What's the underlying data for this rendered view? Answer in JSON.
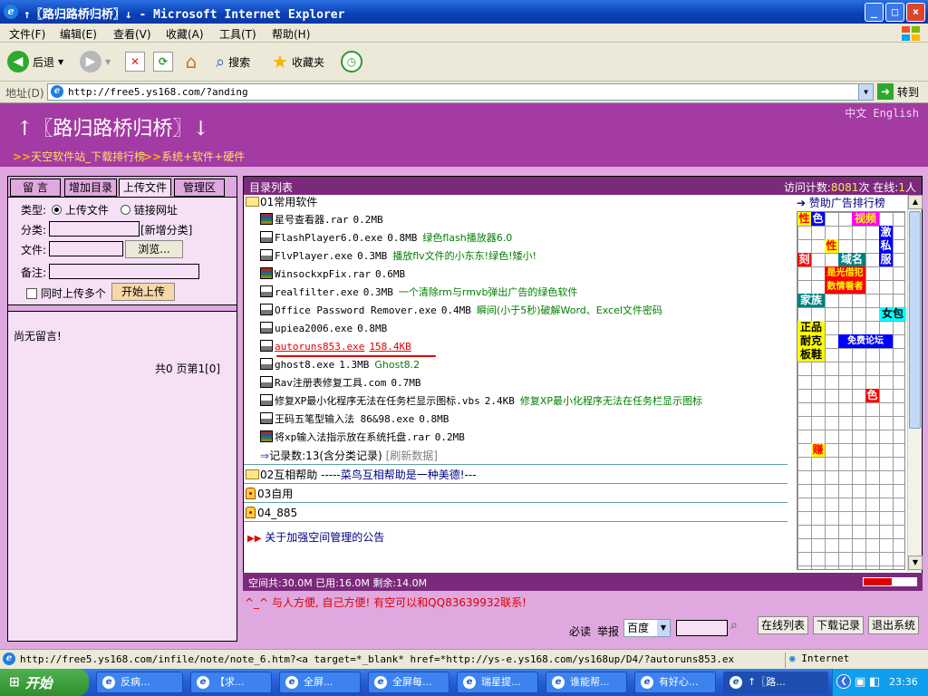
{
  "window": {
    "title": "↑〖路归路桥归桥〗↓ - Microsoft Internet Explorer",
    "controls": {
      "minimize": "_",
      "maximize": "□",
      "close": "×"
    }
  },
  "menu": [
    "文件(F)",
    "编辑(E)",
    "查看(V)",
    "收藏(A)",
    "工具(T)",
    "帮助(H)"
  ],
  "toolbar": {
    "back": "后退",
    "search": "搜索",
    "favorites": "收藏夹"
  },
  "address": {
    "label": "地址(D)",
    "url": "http://free5.ys168.com/?anding",
    "go": "转到"
  },
  "header": {
    "title": "↑〖路归路桥归桥〗↓",
    "lang": "中文 English",
    "link1_prefix": ">>",
    "link1": "天空软件站_下载排行榜",
    "link2_prefix": ">>",
    "link2": "系统+软件+硬件"
  },
  "left": {
    "tabs": [
      "留 言",
      "增加目录",
      "上传文件",
      "管理区"
    ],
    "type_label": "类型:",
    "radio_upload": "上传文件",
    "radio_link": "链接网址",
    "category_label": "分类:",
    "new_category": "[新增分类]",
    "file_label": "文件:",
    "browse": "浏览...",
    "note_label": "备注:",
    "multi_upload": "同时上传多个",
    "start_upload": "开始上传",
    "no_message": "尚无留言!",
    "paging": "共0 页第1[0]"
  },
  "main": {
    "title": "目录列表",
    "counter_prefix": "访问计数:",
    "counter": "8081",
    "counter_unit": "次",
    "online_prefix": "在线:",
    "online": "1",
    "online_unit": "人",
    "folder1": "01常用软件",
    "files": [
      {
        "icon": "rar",
        "name": "星号查看器.rar",
        "size": "0.2MB",
        "note": ""
      },
      {
        "icon": "disk",
        "name": "FlashPlayer6.0.exe",
        "size": "0.8MB",
        "note": "绿色flash播放器6.0"
      },
      {
        "icon": "disk",
        "name": "FlvPlayer.exe",
        "size": "0.3MB",
        "note": "播放flv文件的小东东!绿色!矮小!"
      },
      {
        "icon": "rar",
        "name": "WinsockxpFix.rar",
        "size": "0.6MB",
        "note": ""
      },
      {
        "icon": "disk",
        "name": "realfilter.exe",
        "size": "0.3MB",
        "note": "一个清除rm与rmvb弹出广告的绿色软件"
      },
      {
        "icon": "disk",
        "name": "Office Password Remover.exe",
        "size": "0.4MB",
        "note": "瞬间(小于5秒)破解Word、Excel文件密码"
      },
      {
        "icon": "disk",
        "name": "upiea2006.exe",
        "size": "0.8MB",
        "note": ""
      },
      {
        "icon": "disk",
        "name": "autoruns853.exe",
        "size": "158.4KB",
        "note": ""
      },
      {
        "icon": "disk",
        "name": "ghost8.exe",
        "size": "1.3MB",
        "note": "Ghost8.2"
      },
      {
        "icon": "disk",
        "name": "Rav注册表修复工具.com",
        "size": "0.7MB",
        "note": ""
      },
      {
        "icon": "disk",
        "name": "修复XP最小化程序无法在任务栏显示图标.vbs",
        "size": "2.4KB",
        "note": "修复XP最小化程序无法在任务栏显示图标"
      },
      {
        "icon": "disk",
        "name": "王码五笔型输入法 86&98.exe",
        "size": "0.8MB",
        "note": ""
      },
      {
        "icon": "rar",
        "name": "将xp输入法指示放在系统托盘.rar",
        "size": "0.2MB",
        "note": ""
      }
    ],
    "record_count": "记录数:13(含分类记录)",
    "refresh": "[刷新数据]",
    "folder2": "02互相帮助",
    "folder2_note": "-----菜鸟互相帮助是一种美德!---",
    "folder3": "03自用",
    "folder4": "04_885",
    "notice": "关于加强空间管理的公告",
    "ad_title": "赞助广告排行榜",
    "ads": [
      {
        "text": "性",
        "color": "#ff0000",
        "bg": "#ffff00"
      },
      {
        "text": "色",
        "color": "#ffffff",
        "bg": "#0000ff"
      },
      {
        "text": "视频",
        "color": "#ffff00",
        "bg": "#ff00ff"
      },
      {
        "text": "激",
        "color": "#ffffff",
        "bg": "#0000ff"
      },
      {
        "text": "性",
        "color": "#ff0000",
        "bg": "#ffff00"
      },
      {
        "text": "私",
        "color": "#ffffff",
        "bg": "#0000ff"
      },
      {
        "text": "刻",
        "color": "#ffffff",
        "bg": "#ff0000"
      },
      {
        "text": "域名",
        "color": "#ffffff",
        "bg": "#008080"
      },
      {
        "text": "服",
        "color": "#ffffff",
        "bg": "#0000ff"
      },
      {
        "text": "是光借犯",
        "color": "#ffff00",
        "bg": "#ff0000"
      },
      {
        "text": "数情看者",
        "color": "#ffff00",
        "bg": "#ff0000"
      },
      {
        "text": "家族",
        "color": "#ffffff",
        "bg": "#008080"
      },
      {
        "text": "女包",
        "color": "#000000",
        "bg": "#00ffff"
      },
      {
        "text": "正品",
        "color": "#000000",
        "bg": "#ffff00"
      },
      {
        "text": "耐克",
        "color": "#000000",
        "bg": "#ffff00"
      },
      {
        "text": "免费论坛",
        "color": "#ffffff",
        "bg": "#0000ff"
      },
      {
        "text": "板鞋",
        "color": "#000000",
        "bg": "#ffff00"
      },
      {
        "text": "色",
        "color": "#ffffff",
        "bg": "#ff0000"
      },
      {
        "text": "赚",
        "color": "#ff0000",
        "bg": "#ffff00"
      }
    ],
    "space": "空间共:30.0M 已用:16.0M 剩余:14.0M",
    "space_used_fraction": 0.53
  },
  "bottom": {
    "slogan": "^_^ 与人方便, 自己方便! 有空可以和QQ83639932联系!",
    "must_read": "必读",
    "report": "举报",
    "search_engine": "百度",
    "online_list": "在线列表",
    "download_log": "下载记录",
    "exit": "退出系统"
  },
  "statusbar": {
    "text": "http://free5.ys168.com/infile/note/note_6.htm?<a  target=*_blank* href=*http://ys-e.ys168.com/ys168up/D4/?autoruns853.ex",
    "zone": "Internet"
  },
  "taskbar": {
    "start": "开始",
    "tasks": [
      "反病...",
      "【求...",
      "全屏...",
      "全屏每...",
      "瑞星提...",
      "谁能帮...",
      "有好心...",
      "↑〖路..."
    ],
    "time": "23:36"
  }
}
